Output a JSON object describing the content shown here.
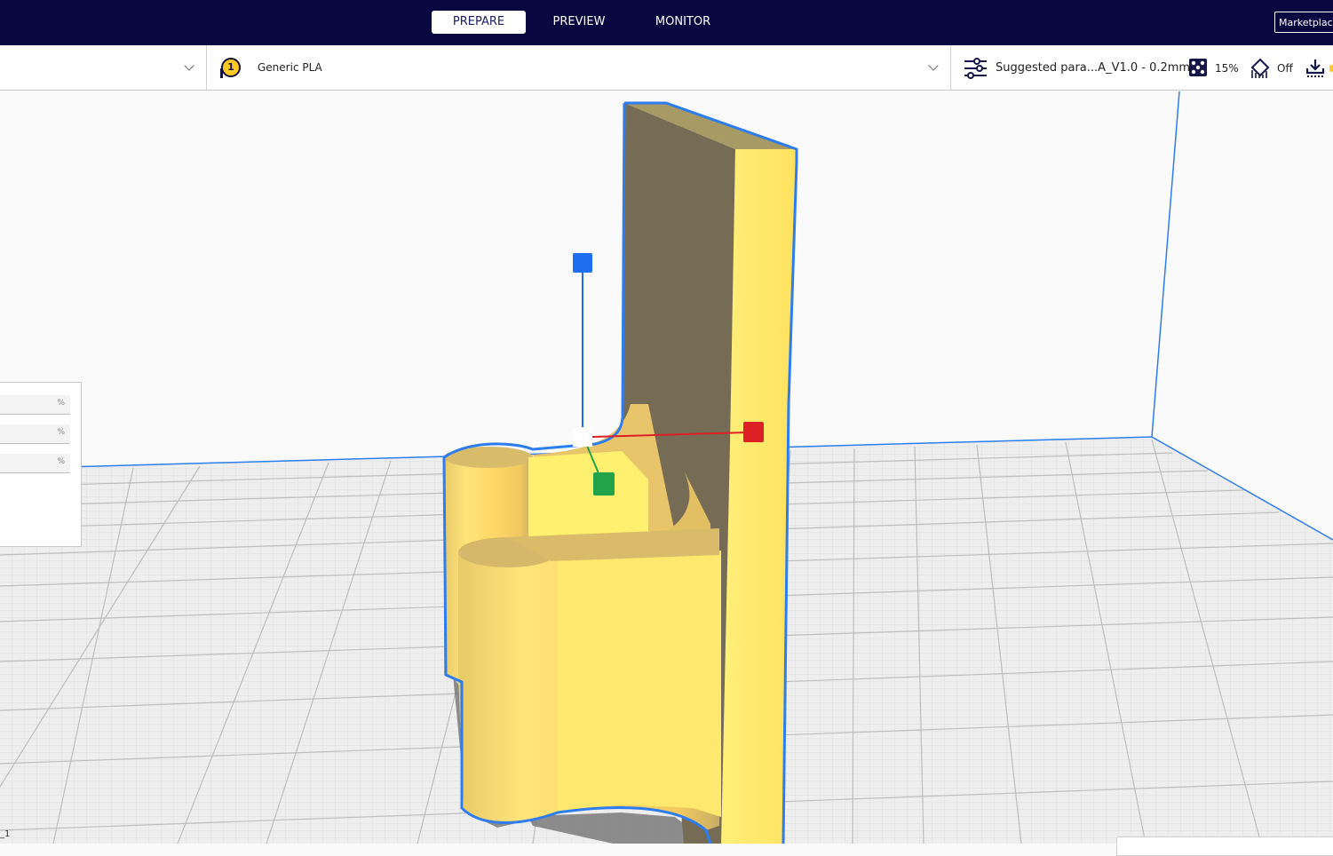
{
  "topbar": {
    "stages": [
      {
        "label": "PREPARE",
        "active": true
      },
      {
        "label": "PREVIEW",
        "active": false
      },
      {
        "label": "MONITOR",
        "active": false
      }
    ],
    "marketplace_label": "Marketplace"
  },
  "header": {
    "printer": {
      "name": "",
      "dropdown_icon": "chevron-down-icon"
    },
    "material": {
      "extruder_number": "1",
      "name": "Generic PLA",
      "dropdown_icon": "chevron-down-icon"
    },
    "print_settings": {
      "profile_icon": "sliders-icon",
      "profile_name": "Suggested para...A_V1.0 - 0.2mm",
      "infill_icon": "infill-icon",
      "infill_value": "15%",
      "support_icon": "support-icon",
      "support_value": "Off",
      "adhesion_icon": "adhesion-icon"
    }
  },
  "scale_panel": {
    "fields": [
      {
        "axis": "x",
        "value": "",
        "unit": "%"
      },
      {
        "axis": "y",
        "value": "",
        "unit": "%"
      },
      {
        "axis": "z",
        "value": "",
        "unit": "%"
      }
    ]
  },
  "viewport": {
    "object_label": "_1",
    "model_color": "#ffe46b",
    "selection_outline_color": "#2d7df0",
    "gizmo": {
      "x_color": "#dd1f26",
      "y_color": "#22a24a",
      "z_color": "#1e6ff0"
    }
  }
}
